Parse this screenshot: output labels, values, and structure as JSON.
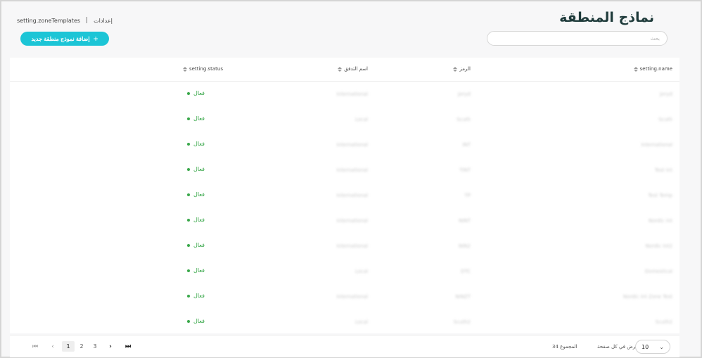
{
  "header": {
    "title": "نماذج المنطقة",
    "breadcrumb": {
      "current": "setting.zoneTemplates",
      "separator": "|",
      "parent": "إعدادات"
    },
    "add_button_label": "إضافة نموذج منطقة جديد",
    "search_placeholder": "بحث"
  },
  "table": {
    "columns": {
      "name": "setting.name",
      "code": "الرمز",
      "flow": "اسم التدفق",
      "status": "setting.status"
    },
    "rows": [
      {
        "name": "Jeryd",
        "code": "Jeryd",
        "flow": "International",
        "status": "فعال"
      },
      {
        "name": "Scuth",
        "code": "Scuth",
        "flow": "Local",
        "status": "فعال"
      },
      {
        "name": "International",
        "code": "INT",
        "flow": "International",
        "status": "فعال"
      },
      {
        "name": "Test Int",
        "code": "TINT",
        "flow": "International",
        "status": "فعال"
      },
      {
        "name": "Test Temp",
        "code": "TP",
        "flow": "International",
        "status": "فعال"
      },
      {
        "name": "Nordic Int",
        "code": "NINT",
        "flow": "International",
        "status": "فعال"
      },
      {
        "name": "Nordic Int2",
        "code": "NIN2",
        "flow": "International",
        "status": "فعال"
      },
      {
        "name": "Domestical",
        "code": "DTC",
        "flow": "Local",
        "status": "فعال"
      },
      {
        "name": "Nordic Int Zone Test",
        "code": "NINZT",
        "flow": "International",
        "status": "فعال"
      },
      {
        "name": "Scuth2",
        "code": "Scuth2",
        "flow": "Local",
        "status": "فعال"
      }
    ]
  },
  "pagination": {
    "pages": [
      "1",
      "2",
      "3"
    ],
    "current_page": "1",
    "total_text": "المجموع 34",
    "per_page_label": "عرض في كل صفحة",
    "per_page_value": "10"
  },
  "colors": {
    "accent": "#1cc5d6",
    "status_active": "#3aa84b",
    "title": "#1f3b3b"
  }
}
